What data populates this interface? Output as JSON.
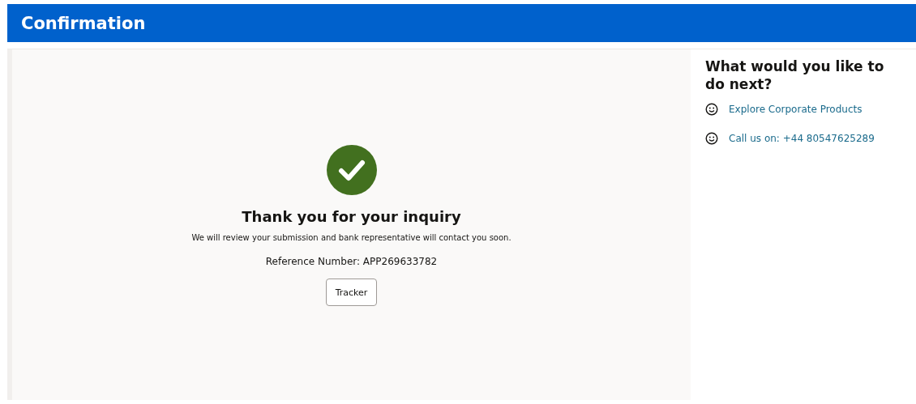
{
  "header": {
    "title": "Confirmation"
  },
  "confirmation": {
    "heading": "Thank you for your inquiry",
    "message": "We will review your submission and bank representative will contact you soon.",
    "reference": "Reference Number: APP269633782",
    "button": "Tracker"
  },
  "next_steps": {
    "heading": "What would you like to do next?",
    "links": [
      {
        "label": "Explore Corporate Products"
      },
      {
        "label": "Call us on: +44 80547625289"
      }
    ]
  }
}
